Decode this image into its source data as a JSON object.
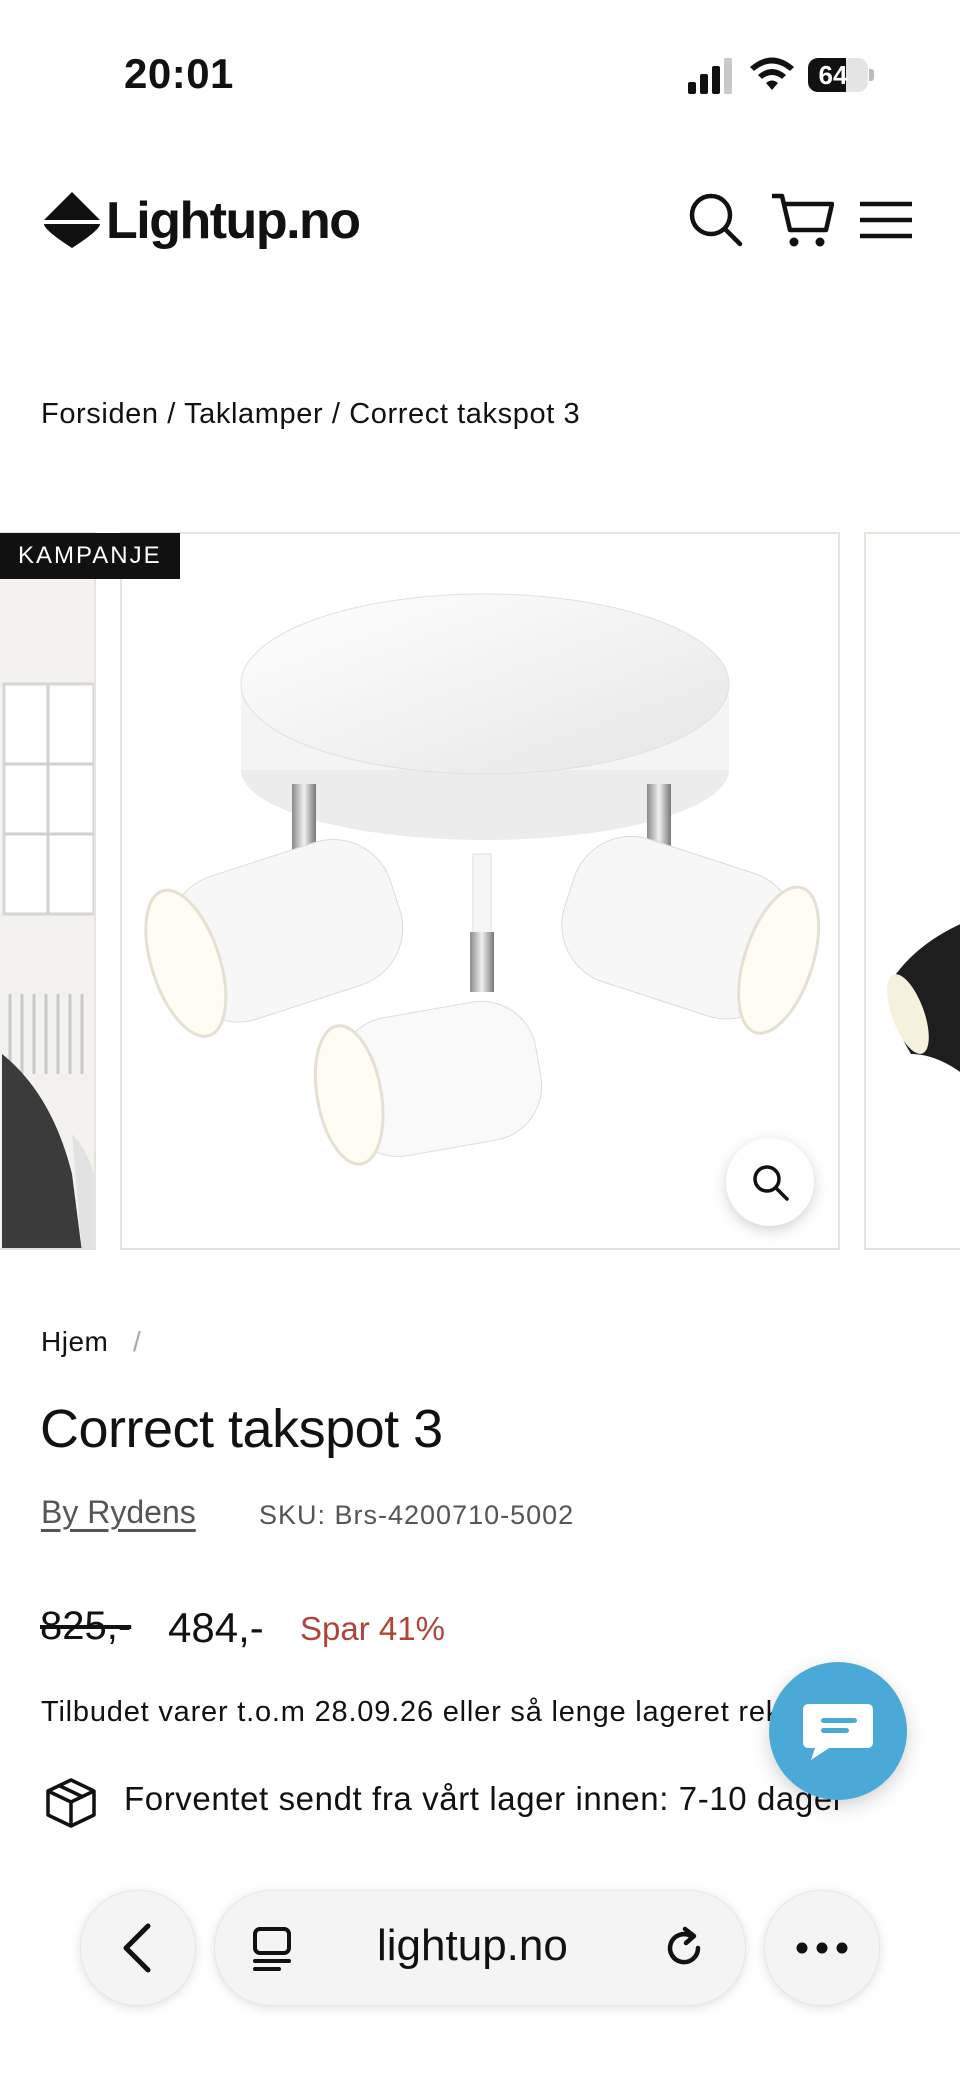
{
  "status_bar": {
    "time": "20:01",
    "battery_level": "64",
    "icons": [
      "signal-icon",
      "wifi-icon",
      "battery-icon"
    ]
  },
  "header": {
    "logo_text": "Lightup.no",
    "icons": [
      "search-icon",
      "cart-icon",
      "menu-icon"
    ]
  },
  "breadcrumb": {
    "text": "Forsiden / Taklamper / Correct takspot 3"
  },
  "gallery": {
    "badge": "KAMPANJE",
    "zoom_icon": "zoom-icon"
  },
  "product": {
    "home_crumb": "Hjem",
    "home_sep": "/",
    "title": "Correct takspot 3",
    "brand": "By Rydens",
    "sku": "SKU: Brs-4200710-5002",
    "old_price": "825,-",
    "price": "484,-",
    "save": "Spar 41%",
    "offer": "Tilbudet varer t.o.m 28.09.26 eller så lenge lageret rekker",
    "shipping": "Forventet sendt fra vårt lager innen: 7-10 dager"
  },
  "browser": {
    "url": "lightup.no",
    "icons": [
      "back-icon",
      "tabs-icon",
      "reload-icon",
      "more-icon"
    ]
  },
  "colors": {
    "accent_sale": "#b0443a",
    "chat_bubble": "#4ba9d8",
    "text": "#111111"
  }
}
